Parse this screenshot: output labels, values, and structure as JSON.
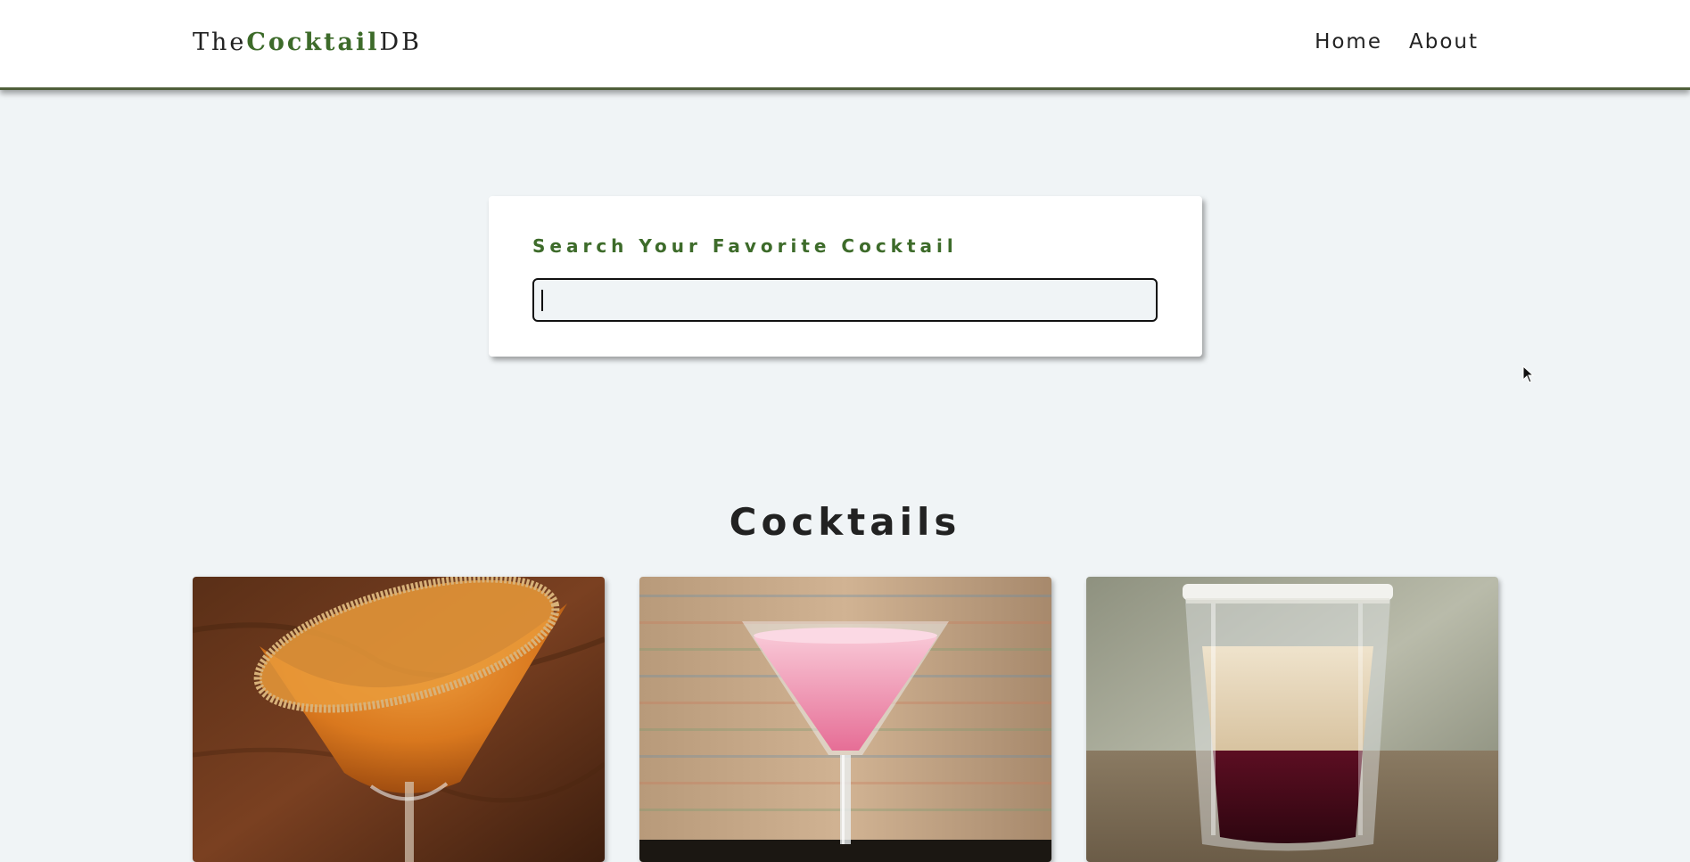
{
  "navbar": {
    "logo_prefix": "The",
    "logo_accent": "Cocktail",
    "logo_suffix": "DB",
    "links": [
      "Home",
      "About"
    ]
  },
  "search": {
    "label": "Search Your Favorite Cocktail",
    "value": "",
    "placeholder": ""
  },
  "section": {
    "title": "Cocktails"
  },
  "cocktails": [
    {
      "image": "orange-martini-sugar-rim"
    },
    {
      "image": "pink-martini"
    },
    {
      "image": "layered-shot"
    }
  ],
  "colors": {
    "accent": "#3d6b2a",
    "background": "#f0f4f6",
    "navbar_border": "#4f5f3a"
  }
}
